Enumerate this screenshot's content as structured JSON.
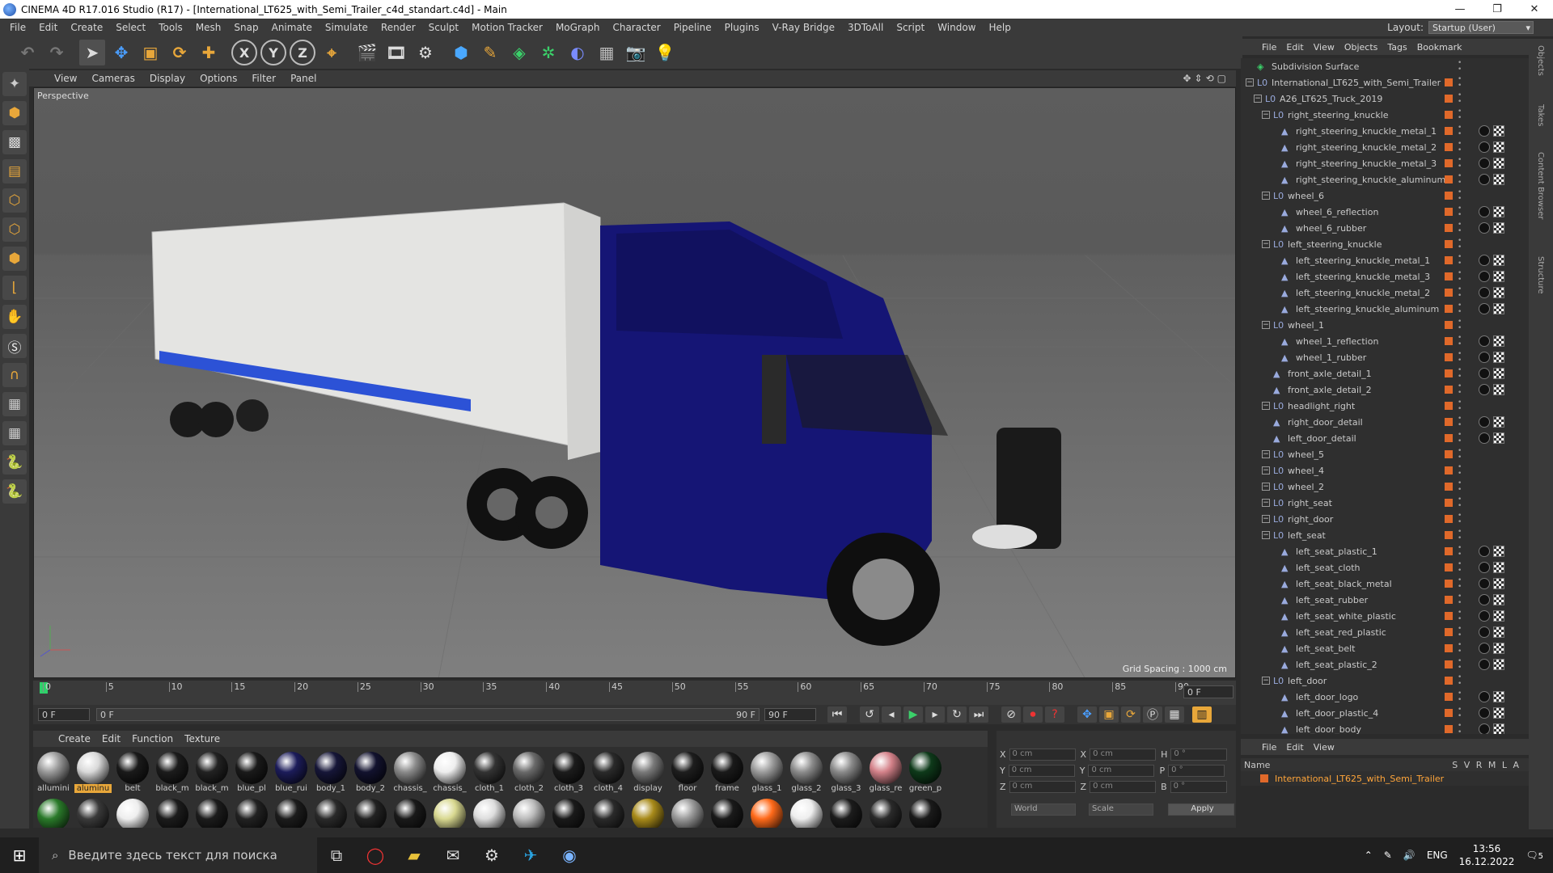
{
  "window": {
    "title": "CINEMA 4D R17.016 Studio (R17) - [International_LT625_with_Semi_Trailer_c4d_standart.c4d] - Main",
    "min_glyph": "—",
    "max_glyph": "❐",
    "close_glyph": "✕"
  },
  "menubar": [
    "File",
    "Edit",
    "Create",
    "Select",
    "Tools",
    "Mesh",
    "Snap",
    "Animate",
    "Simulate",
    "Render",
    "Sculpt",
    "Motion Tracker",
    "MoGraph",
    "Character",
    "Pipeline",
    "Plugins",
    "V-Ray Bridge",
    "3DToAll",
    "Script",
    "Window",
    "Help"
  ],
  "layout": {
    "label": "Layout:",
    "value": "Startup (User)"
  },
  "toolbar": {
    "axis_x": "X",
    "axis_y": "Y",
    "axis_z": "Z"
  },
  "viewport": {
    "menu": [
      "View",
      "Cameras",
      "Display",
      "Options",
      "Filter",
      "Panel"
    ],
    "label": "Perspective",
    "grid_spacing": "Grid Spacing : 1000 cm"
  },
  "timeline": {
    "ticks": [
      "0",
      "5",
      "10",
      "15",
      "20",
      "25",
      "30",
      "35",
      "40",
      "45",
      "50",
      "55",
      "60",
      "65",
      "70",
      "75",
      "80",
      "85",
      "90"
    ],
    "end_field": "0 F",
    "start": "0 F",
    "range_start": "0 F",
    "range_end": "90 F",
    "max": "90 F"
  },
  "materials": {
    "menu": [
      "Create",
      "Edit",
      "Function",
      "Texture"
    ],
    "row1": [
      {
        "label": "allumini",
        "color": "#9a9a9a"
      },
      {
        "label": "aluminu",
        "color": "#d9d9d9"
      },
      {
        "label": "belt",
        "color": "#1a1a1a"
      },
      {
        "label": "black_m",
        "color": "#1c1c1c"
      },
      {
        "label": "black_m",
        "color": "#222222"
      },
      {
        "label": "blue_pl",
        "color": "#1a1a1a"
      },
      {
        "label": "blue_rui",
        "color": "#1c1c5a"
      },
      {
        "label": "body_1",
        "color": "#161638"
      },
      {
        "label": "body_2",
        "color": "#12122e"
      },
      {
        "label": "chassis_",
        "color": "#8a8a8a"
      },
      {
        "label": "chassis_",
        "color": "#eeeeee"
      },
      {
        "label": "cloth_1",
        "color": "#333333"
      },
      {
        "label": "cloth_2",
        "color": "#6a6a6a"
      },
      {
        "label": "cloth_3",
        "color": "#1c1c1c"
      },
      {
        "label": "cloth_4",
        "color": "#2a2a2a"
      },
      {
        "label": "display",
        "color": "#7a7a7a"
      },
      {
        "label": "floor",
        "color": "#1e1e1e"
      },
      {
        "label": "frame",
        "color": "#1a1a1a"
      },
      {
        "label": "glass_1",
        "color": "#9c9c9c"
      },
      {
        "label": "glass_2",
        "color": "#8c8c8c"
      },
      {
        "label": "glass_3",
        "color": "#8a8a8a"
      },
      {
        "label": "glass_re",
        "color": "#d4828a"
      },
      {
        "label": "green_p",
        "color": "#0e3a1a"
      }
    ],
    "row2_colors": [
      "#2a7a2a",
      "#3a3a3a",
      "#eeeeee",
      "#1c1c1c",
      "#1c1c1c",
      "#222222",
      "#1c1c1c",
      "#2a2a2a",
      "#222222",
      "#1a1a1a",
      "#d8d890",
      "#dddddd",
      "#bbbbbb",
      "#1a1a1a",
      "#2a2a2a",
      "#a88a1a",
      "#9a9a9a",
      "#1a1a1a",
      "#ff6a1a",
      "#eeeeee",
      "#1c1c1c",
      "#2a2a2a",
      "#1a1a1a"
    ]
  },
  "coords": {
    "pos_x": "0 cm",
    "pos_y": "0 cm",
    "pos_z": "0 cm",
    "size_x": "0 cm",
    "size_y": "0 cm",
    "size_z": "0 cm",
    "rot_h": "0 °",
    "rot_p": "0 °",
    "rot_b": "0 °",
    "world": "World",
    "scale": "Scale",
    "apply": "Apply"
  },
  "objects_panel": {
    "menu": [
      "File",
      "Edit",
      "View",
      "Objects",
      "Tags",
      "Bookmark"
    ],
    "items": [
      {
        "name": "Subdivision Surface",
        "depth": 0,
        "exp": false,
        "tags": 0,
        "checks": true
      },
      {
        "name": "International_LT625_with_Semi_Trailer",
        "depth": 0,
        "exp": true,
        "tags": 0
      },
      {
        "name": "A26_LT625_Truck_2019",
        "depth": 1,
        "exp": true,
        "tags": 0
      },
      {
        "name": "right_steering_knuckle",
        "depth": 2,
        "exp": true,
        "tags": 0
      },
      {
        "name": "right_steering_knuckle_metal_1",
        "depth": 3,
        "exp": false,
        "tags": 2
      },
      {
        "name": "right_steering_knuckle_metal_2",
        "depth": 3,
        "exp": false,
        "tags": 2
      },
      {
        "name": "right_steering_knuckle_metal_3",
        "depth": 3,
        "exp": false,
        "tags": 2
      },
      {
        "name": "right_steering_knuckle_aluminum",
        "depth": 3,
        "exp": false,
        "tags": 2
      },
      {
        "name": "wheel_6",
        "depth": 2,
        "exp": true,
        "tags": 0
      },
      {
        "name": "wheel_6_reflection",
        "depth": 3,
        "exp": false,
        "tags": 2
      },
      {
        "name": "wheel_6_rubber",
        "depth": 3,
        "exp": false,
        "tags": 2
      },
      {
        "name": "left_steering_knuckle",
        "depth": 2,
        "exp": true,
        "tags": 0
      },
      {
        "name": "left_steering_knuckle_metal_1",
        "depth": 3,
        "exp": false,
        "tags": 2
      },
      {
        "name": "left_steering_knuckle_metal_3",
        "depth": 3,
        "exp": false,
        "tags": 2
      },
      {
        "name": "left_steering_knuckle_metal_2",
        "depth": 3,
        "exp": false,
        "tags": 2
      },
      {
        "name": "left_steering_knuckle_aluminum",
        "depth": 3,
        "exp": false,
        "tags": 2
      },
      {
        "name": "wheel_1",
        "depth": 2,
        "exp": true,
        "tags": 0
      },
      {
        "name": "wheel_1_reflection",
        "depth": 3,
        "exp": false,
        "tags": 2
      },
      {
        "name": "wheel_1_rubber",
        "depth": 3,
        "exp": false,
        "tags": 2
      },
      {
        "name": "front_axle_detail_1",
        "depth": 2,
        "exp": false,
        "tags": 2
      },
      {
        "name": "front_axle_detail_2",
        "depth": 2,
        "exp": false,
        "tags": 2
      },
      {
        "name": "headlight_right",
        "depth": 2,
        "exp": true,
        "tags": 0
      },
      {
        "name": "right_door_detail",
        "depth": 2,
        "exp": false,
        "tags": 2
      },
      {
        "name": "left_door_detail",
        "depth": 2,
        "exp": false,
        "tags": 2
      },
      {
        "name": "wheel_5",
        "depth": 2,
        "exp": true,
        "tags": 0
      },
      {
        "name": "wheel_4",
        "depth": 2,
        "exp": true,
        "tags": 0
      },
      {
        "name": "wheel_2",
        "depth": 2,
        "exp": true,
        "tags": 0
      },
      {
        "name": "right_seat",
        "depth": 2,
        "exp": true,
        "tags": 0
      },
      {
        "name": "right_door",
        "depth": 2,
        "exp": true,
        "tags": 0
      },
      {
        "name": "left_seat",
        "depth": 2,
        "exp": true,
        "tags": 0
      },
      {
        "name": "left_seat_plastic_1",
        "depth": 3,
        "exp": false,
        "tags": 2
      },
      {
        "name": "left_seat_cloth",
        "depth": 3,
        "exp": false,
        "tags": 2
      },
      {
        "name": "left_seat_black_metal",
        "depth": 3,
        "exp": false,
        "tags": 2
      },
      {
        "name": "left_seat_rubber",
        "depth": 3,
        "exp": false,
        "tags": 2
      },
      {
        "name": "left_seat_white_plastic",
        "depth": 3,
        "exp": false,
        "tags": 2
      },
      {
        "name": "left_seat_red_plastic",
        "depth": 3,
        "exp": false,
        "tags": 2
      },
      {
        "name": "left_seat_belt",
        "depth": 3,
        "exp": false,
        "tags": 2
      },
      {
        "name": "left_seat_plastic_2",
        "depth": 3,
        "exp": false,
        "tags": 2
      },
      {
        "name": "left_door",
        "depth": 2,
        "exp": true,
        "tags": 0
      },
      {
        "name": "left_door_logo",
        "depth": 3,
        "exp": false,
        "tags": 2
      },
      {
        "name": "left_door_plastic_4",
        "depth": 3,
        "exp": false,
        "tags": 2
      },
      {
        "name": "left_door_body",
        "depth": 3,
        "exp": false,
        "tags": 2
      }
    ]
  },
  "attributes_panel": {
    "menu": [
      "File",
      "Edit",
      "View"
    ],
    "header_name": "Name",
    "header_cols": "S V R M L A",
    "row": "International_LT625_with_Semi_Trailer"
  },
  "right_strip": [
    "Objects",
    "Takes",
    "Content Browser",
    "Structure"
  ],
  "taskbar": {
    "search_placeholder": "Введите здесь текст для поиска",
    "lang": "ENG",
    "time": "13:56",
    "date": "16.12.2022",
    "notif": "5"
  }
}
